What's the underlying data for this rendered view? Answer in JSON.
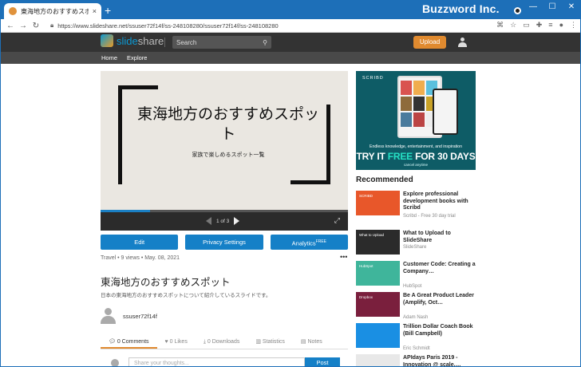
{
  "browser": {
    "tab_title": "東海地方のおすすめスポット",
    "tab_close": "×",
    "new_tab": "+",
    "brand": "Buzzword Inc.",
    "url": "https://www.slideshare.net/ssuser72f14f/ss-248108280/ssuser72f14f/ss-248108280",
    "win_min": "—",
    "win_max": "☐",
    "win_close": "✕"
  },
  "site": {
    "logo_prefix": "slide",
    "logo_suffix": "share",
    "search_placeholder": "Search",
    "upload_label": "Upload",
    "nav": [
      "Home",
      "Explore"
    ]
  },
  "slide": {
    "title": "東海地方のおすすめスポット",
    "subtitle": "家族で楽しめるスポット一覧",
    "page": "1 of 3",
    "progress": 0.2
  },
  "actions": {
    "edit": "Edit",
    "privacy": "Privacy Settings",
    "analytics": "Analytics",
    "analytics_badge": "FREE"
  },
  "meta": "Travel • 9 views • May. 08, 2021",
  "more": "•••",
  "heading": "東海地方のおすすめスポット",
  "description": "日本の東海地方のおすすめスポットについて紹介しているスライドです。",
  "username": "ssuser72f14f",
  "tabs": [
    "0 Comments",
    "0 Likes",
    "0 Downloads",
    "Statistics",
    "Notes"
  ],
  "comment": {
    "placeholder": "Share your thoughts...",
    "post": "Post"
  },
  "ad": {
    "brand": "SCRIBD",
    "line1": "Endless knowledge, entertainment, and inspiration",
    "line2a": "TRY IT ",
    "line2b": "FREE",
    "line2c": " FOR 30 DAYS",
    "line3": "cancel anytime",
    "colors": {
      "bg": "#0e5c66",
      "accent": "#26e0c4"
    }
  },
  "recommended": {
    "heading": "Recommended",
    "items": [
      {
        "title": "Explore professional development books with Scribd",
        "source": "Scribd - Free 30 day trial",
        "color": "#e8572a",
        "thumb_text": "SCRIBD"
      },
      {
        "title": "What to Upload to SlideShare",
        "source": "SlideShare",
        "color": "#2b2b2b",
        "thumb_text": "What to Upload"
      },
      {
        "title": "Customer Code: Creating a Company…",
        "source": "HubSpot",
        "color": "#3fb59b",
        "thumb_text": "HubSpot"
      },
      {
        "title": "Be A Great Product Leader (Amplify, Oct…",
        "source": "Adam Nash",
        "color": "#7a1f3d",
        "thumb_text": "Dropbox"
      },
      {
        "title": "Trillion Dollar Coach Book (Bill Campbell)",
        "source": "Eric Schmidt",
        "color": "#1a8fe3",
        "thumb_text": ""
      },
      {
        "title": "APIdays Paris 2019 - Innovation @ scale,…",
        "source": "",
        "color": "#e8e8e8",
        "thumb_text": ""
      }
    ]
  }
}
